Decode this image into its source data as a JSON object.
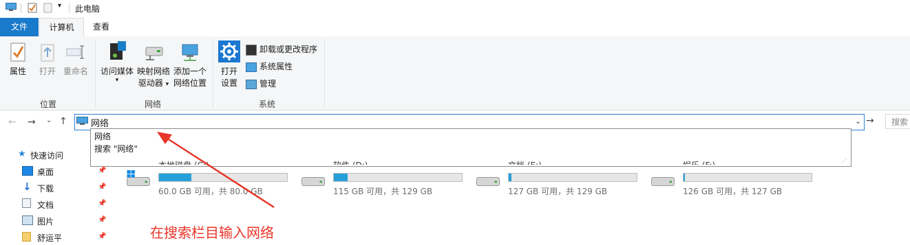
{
  "window": {
    "title": "此电脑"
  },
  "tabs": [
    {
      "label": "文件"
    },
    {
      "label": "计算机"
    },
    {
      "label": "查看"
    }
  ],
  "ribbon": {
    "location": {
      "label": "位置",
      "buttons": [
        {
          "label": "属性"
        },
        {
          "label": "打开"
        },
        {
          "label": "重命名"
        }
      ]
    },
    "network": {
      "label": "网络",
      "buttons": [
        {
          "line1": "访问媒体",
          "line2": ""
        },
        {
          "line1": "映射网络",
          "line2": "驱动器"
        },
        {
          "line1": "添加一个",
          "line2": "网络位置"
        }
      ]
    },
    "system": {
      "label": "系统",
      "open_settings": {
        "line1": "打开",
        "line2": "设置"
      },
      "items": [
        {
          "label": "卸载或更改程序"
        },
        {
          "label": "系统属性"
        },
        {
          "label": "管理"
        }
      ]
    }
  },
  "address": {
    "value": "网络",
    "search_placeholder": "搜索"
  },
  "autocomplete": [
    {
      "label": "网络"
    },
    {
      "label": "搜索 \"网络\""
    }
  ],
  "sidebar": [
    {
      "label": "快速访问"
    },
    {
      "label": "桌面"
    },
    {
      "label": "下载"
    },
    {
      "label": "文档"
    },
    {
      "label": "图片"
    },
    {
      "label": "舒运平"
    }
  ],
  "drives": [
    {
      "name": "本地磁盘 (C:)",
      "text": "60.0 GB 可用，共 80.0 GB",
      "used": 0.25
    },
    {
      "name": "软件 (D:)",
      "text": "115 GB 可用，共 129 GB",
      "used": 0.11
    },
    {
      "name": "文档 (E:)",
      "text": "127 GB 可用，共 129 GB",
      "used": 0.02
    },
    {
      "name": "娱乐 (F:)",
      "text": "126 GB 可用，共 127 GB",
      "used": 0.01
    }
  ],
  "annotation": "在搜索栏目输入网络",
  "colors": {
    "accent": "#1979ca",
    "annotation": "#e8362a",
    "drive_fill": "#26a0da"
  }
}
